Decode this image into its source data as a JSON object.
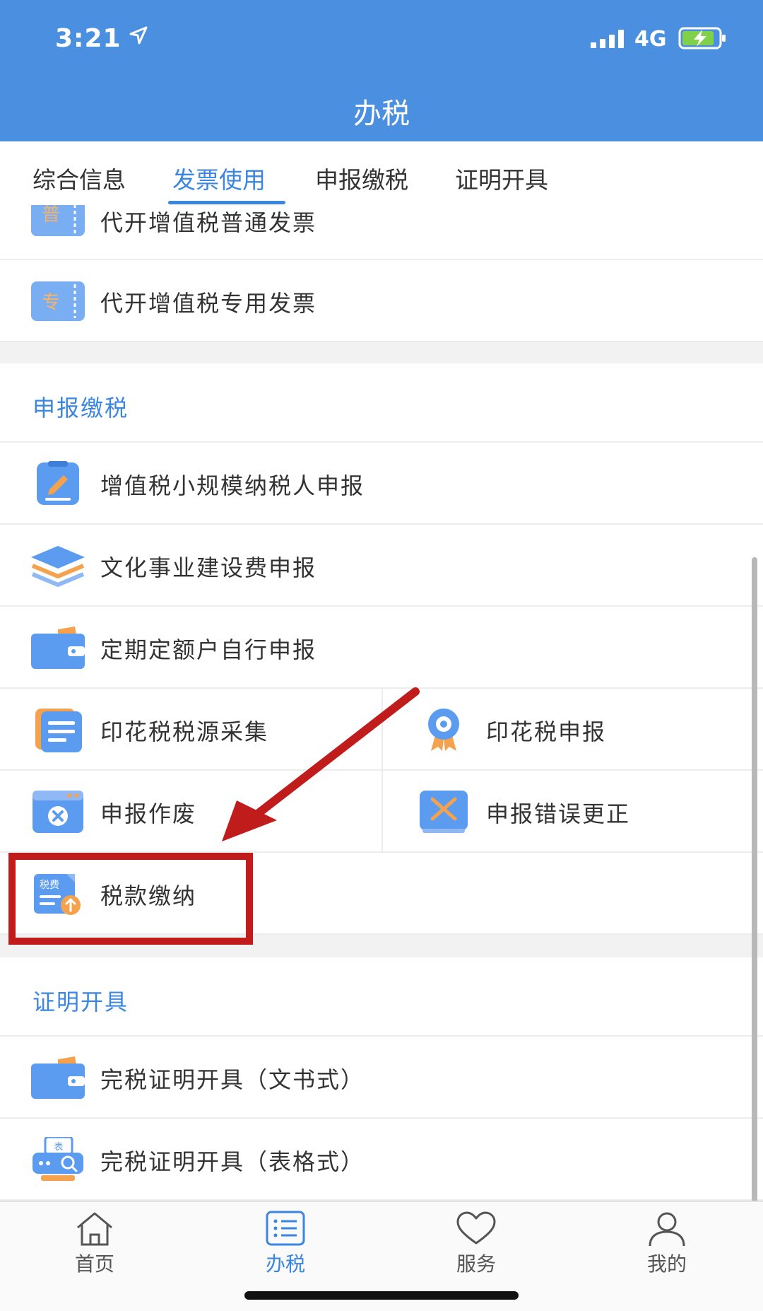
{
  "status_bar": {
    "time": "3:21",
    "network": "4G"
  },
  "nav": {
    "title": "办税"
  },
  "tabs": [
    {
      "label": "综合信息",
      "active": false
    },
    {
      "label": "发票使用",
      "active": true
    },
    {
      "label": "申报缴税",
      "active": false
    },
    {
      "label": "证明开具",
      "active": false
    }
  ],
  "invoice_items": [
    {
      "label": "代开增值税普通发票",
      "icon": "ticket-pu-icon",
      "icon_text": "普"
    },
    {
      "label": "代开增值税专用发票",
      "icon": "ticket-zhuan-icon",
      "icon_text": "专"
    }
  ],
  "declare_section": {
    "title": "申报缴税",
    "items": [
      {
        "label": "增值税小规模纳税人申报",
        "icon": "clipboard-pen-icon"
      },
      {
        "label": "文化事业建设费申报",
        "icon": "layers-icon"
      },
      {
        "label": "定期定额户自行申报",
        "icon": "wallet-icon"
      },
      {
        "label": "印花税税源采集",
        "icon": "documents-icon"
      },
      {
        "label": "印花税申报",
        "icon": "badge-icon"
      },
      {
        "label": "申报作废",
        "icon": "cancel-window-icon"
      },
      {
        "label": "申报错误更正",
        "icon": "correction-icon"
      },
      {
        "label": "税款缴纳",
        "icon": "tax-fee-upload-icon",
        "icon_text": "税费"
      }
    ]
  },
  "certificate_section": {
    "title": "证明开具",
    "items": [
      {
        "label": "完税证明开具（文书式）",
        "icon": "wallet-icon"
      },
      {
        "label": "完税证明开具（表格式）",
        "icon": "table-search-icon",
        "icon_text": "表"
      }
    ]
  },
  "tab_bar": {
    "items": [
      {
        "label": "首页",
        "icon": "home-icon",
        "active": false
      },
      {
        "label": "办税",
        "icon": "list-icon",
        "active": true
      },
      {
        "label": "服务",
        "icon": "heart-icon",
        "active": false
      },
      {
        "label": "我的",
        "icon": "person-icon",
        "active": false
      }
    ]
  },
  "colors": {
    "primary": "#4a8fe0",
    "accent_text": "#3a86e0",
    "highlight": "#c01c1c",
    "icon_blue": "#5b9cf0",
    "icon_orange": "#f4a24d"
  }
}
